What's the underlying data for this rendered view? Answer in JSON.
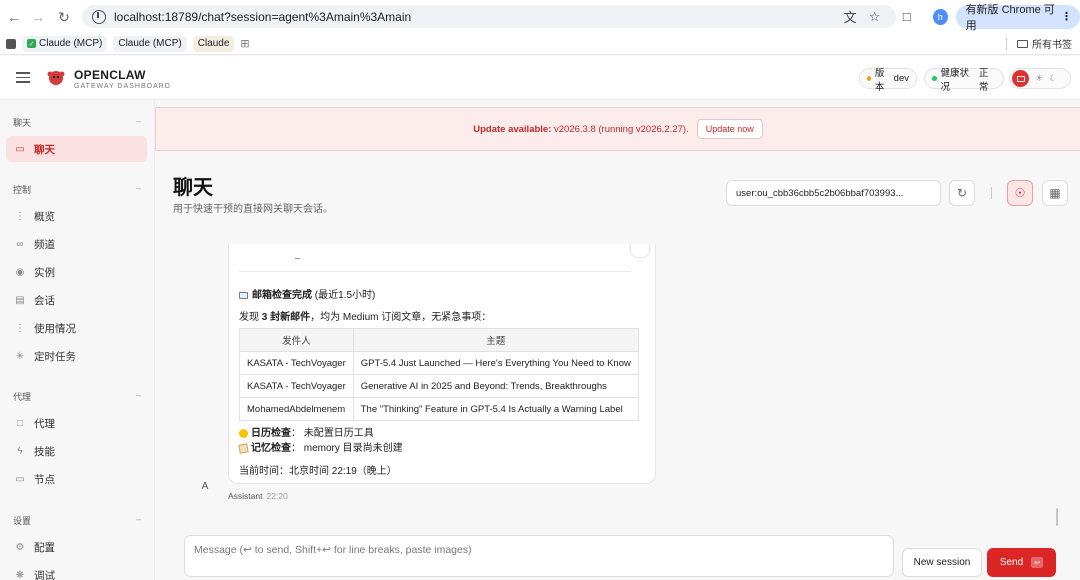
{
  "browser": {
    "url": "localhost:18789/chat?session=agent%3Amain%3Amain",
    "profile_initial": "h",
    "update_label": "有新版 Chrome 可用",
    "bookmarks": [
      "Claude (MCP)",
      "Claude (MCP)",
      "Claude"
    ],
    "all_bookmarks": "所有书签",
    "icons": [
      "back-icon",
      "forward-icon",
      "reload-icon",
      "site-info-icon",
      "translate-icon",
      "star-icon",
      "extensions-icon",
      "kebab-menu-icon"
    ]
  },
  "header": {
    "brand_title": "OPENCLAW",
    "brand_subtitle": "GATEWAY DASHBOARD",
    "version_label": "版本",
    "version_value": "dev",
    "health_label": "健康状况",
    "health_value": "正常",
    "colors": {
      "accent": "#dc2626",
      "version_dot": "#f59e0b",
      "health_dot": "#22c55e"
    }
  },
  "sidebar": {
    "sections": [
      {
        "title": "聊天",
        "items": [
          {
            "label": "聊天",
            "icon": "chat-bubble-icon",
            "active": true
          }
        ]
      },
      {
        "title": "控制",
        "items": [
          {
            "label": "概览",
            "icon": "bar-chart-icon"
          },
          {
            "label": "频道",
            "icon": "link-icon"
          },
          {
            "label": "实例",
            "icon": "radio-icon"
          },
          {
            "label": "会话",
            "icon": "document-icon"
          },
          {
            "label": "使用情况",
            "icon": "bar-chart-icon"
          },
          {
            "label": "定时任务",
            "icon": "loader-icon"
          }
        ]
      },
      {
        "title": "代理",
        "items": [
          {
            "label": "代理",
            "icon": "folder-icon"
          },
          {
            "label": "技能",
            "icon": "zap-icon"
          },
          {
            "label": "节点",
            "icon": "monitor-icon"
          }
        ]
      },
      {
        "title": "设置",
        "items": [
          {
            "label": "配置",
            "icon": "gear-icon"
          },
          {
            "label": "调试",
            "icon": "bug-icon"
          }
        ]
      }
    ]
  },
  "banner": {
    "prefix": "Update available:",
    "text": "v2026.3.8 (running v2026.2.27).",
    "button": "Update now"
  },
  "page": {
    "title": "聊天",
    "subtitle": "用于快速干预的直接网关聊天会话。",
    "session_value": "user:ou_cbb36cbb5c2b06bbaf703993..."
  },
  "message": {
    "mail_heading": "邮箱检查完成",
    "mail_heading_suffix": " (最近1.5小时)",
    "found_prefix": "发现 ",
    "found_bold": "3 封新邮件",
    "found_suffix": "，均为 Medium 订阅文章，无紧急事项：",
    "table_headers": [
      "发件人",
      "主题"
    ],
    "table_rows": [
      [
        "KASATA - TechVoyager",
        "GPT-5.4 Just Launched — Here's Everything You Need to Know"
      ],
      [
        "KASATA - TechVoyager",
        "Generative AI in 2025 and Beyond: Trends, Breakthroughs"
      ],
      [
        "MohamedAbdelmenem",
        "The \"Thinking\" Feature in GPT-5.4 Is Actually a Warning Label"
      ]
    ],
    "calendar_label": "日历检查",
    "calendar_value": "：  未配置日历工具",
    "memory_label": "记忆检查",
    "memory_value": "：  memory 目录尚未创建",
    "time_line": "当前时间：北京时间 22:19（晚上）",
    "avatar": "A",
    "author": "Assistant",
    "timestamp": "22:20"
  },
  "composer": {
    "placeholder": "Message (↩ to send, Shift+↩ for line breaks, paste images)",
    "new_session": "New session",
    "send": "Send"
  }
}
